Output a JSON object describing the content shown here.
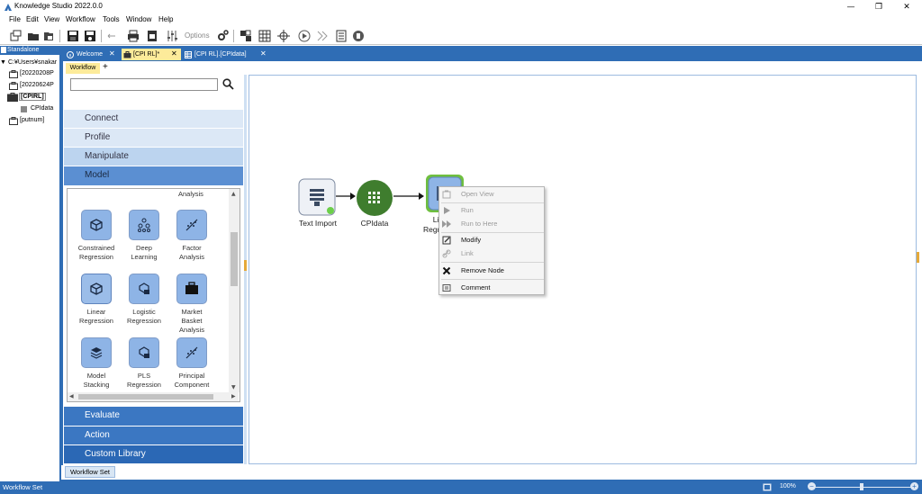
{
  "window": {
    "title": "Knowledge Studio 2022.0.0",
    "minimize": "—",
    "restore": "❐",
    "close": "✕"
  },
  "menu": [
    "File",
    "Edit",
    "View",
    "Workflow",
    "Tools",
    "Window",
    "Help"
  ],
  "toolbar": {
    "options_label": "Options"
  },
  "left_panel": {
    "tab": "Standalone",
    "tree": [
      "C:¥Users¥snakar",
      "[20220208P",
      "[20220624P",
      "[CPIRL]",
      "CPIdata",
      "[putnum]"
    ]
  },
  "doc_tabs": [
    {
      "label": "Welcome",
      "close": "✕"
    },
    {
      "label": "[CPI RL]*",
      "close": "✕"
    },
    {
      "label": "[CPI RL].[CPIdata]",
      "close": "✕"
    }
  ],
  "sub_tab": {
    "label": "Workflow",
    "add": "+"
  },
  "palette": {
    "search_placeholder": "",
    "categories_top": [
      "Connect",
      "Profile",
      "Manipulate",
      "Model"
    ],
    "categories_bottom": [
      "Evaluate",
      "Action",
      "Custom Library"
    ],
    "model_nodes_header": "Analysis",
    "model_nodes": [
      {
        "label1": "Constrained",
        "label2": "Regression",
        "label3": "",
        "icon": "cube-icon"
      },
      {
        "label1": "Deep",
        "label2": "Learning",
        "label3": "",
        "icon": "network-icon"
      },
      {
        "label1": "Factor",
        "label2": "Analysis",
        "label3": "",
        "icon": "scatter-icon"
      },
      {
        "label1": "Linear",
        "label2": "Regression",
        "label3": "",
        "icon": "cube-icon"
      },
      {
        "label1": "Logistic",
        "label2": "Regression",
        "label3": "",
        "icon": "logistic-icon"
      },
      {
        "label1": "Market",
        "label2": "Basket",
        "label3": "Analysis",
        "icon": "basket-icon"
      },
      {
        "label1": "Model",
        "label2": "Stacking",
        "label3": "",
        "icon": "stack-icon"
      },
      {
        "label1": "PLS",
        "label2": "Regression",
        "label3": "",
        "icon": "pls-icon"
      },
      {
        "label1": "Principal",
        "label2": "Component",
        "label3": "",
        "icon": "scatter-icon"
      }
    ]
  },
  "canvas": {
    "nodes": [
      {
        "label": "Text Import"
      },
      {
        "label": "CPIdata"
      },
      {
        "label": "Li",
        "label2": "Regr"
      }
    ]
  },
  "context_menu": [
    {
      "label": "Open View",
      "enabled": false,
      "icon": "open-view-icon"
    },
    {
      "label": "Run",
      "enabled": false,
      "icon": "run-icon"
    },
    {
      "label": "Run to Here",
      "enabled": false,
      "icon": "run-to-here-icon"
    },
    {
      "label": "Modify",
      "enabled": true,
      "icon": "modify-icon"
    },
    {
      "label": "Link",
      "enabled": false,
      "icon": "link-icon"
    },
    {
      "label": "Remove Node",
      "enabled": true,
      "icon": "remove-icon"
    },
    {
      "label": "Comment",
      "enabled": true,
      "icon": "comment-icon"
    }
  ],
  "bottom": {
    "tab": "Workflow Set",
    "status": "Workflow Set",
    "zoom": "100%",
    "zoom_minus": "−",
    "zoom_plus": "+"
  },
  "colors": {
    "frame_blue": "#2f6db5",
    "active_tab": "#fdeb9a",
    "node_blue": "#8eb4e6",
    "node_green": "#3f7d2e"
  }
}
